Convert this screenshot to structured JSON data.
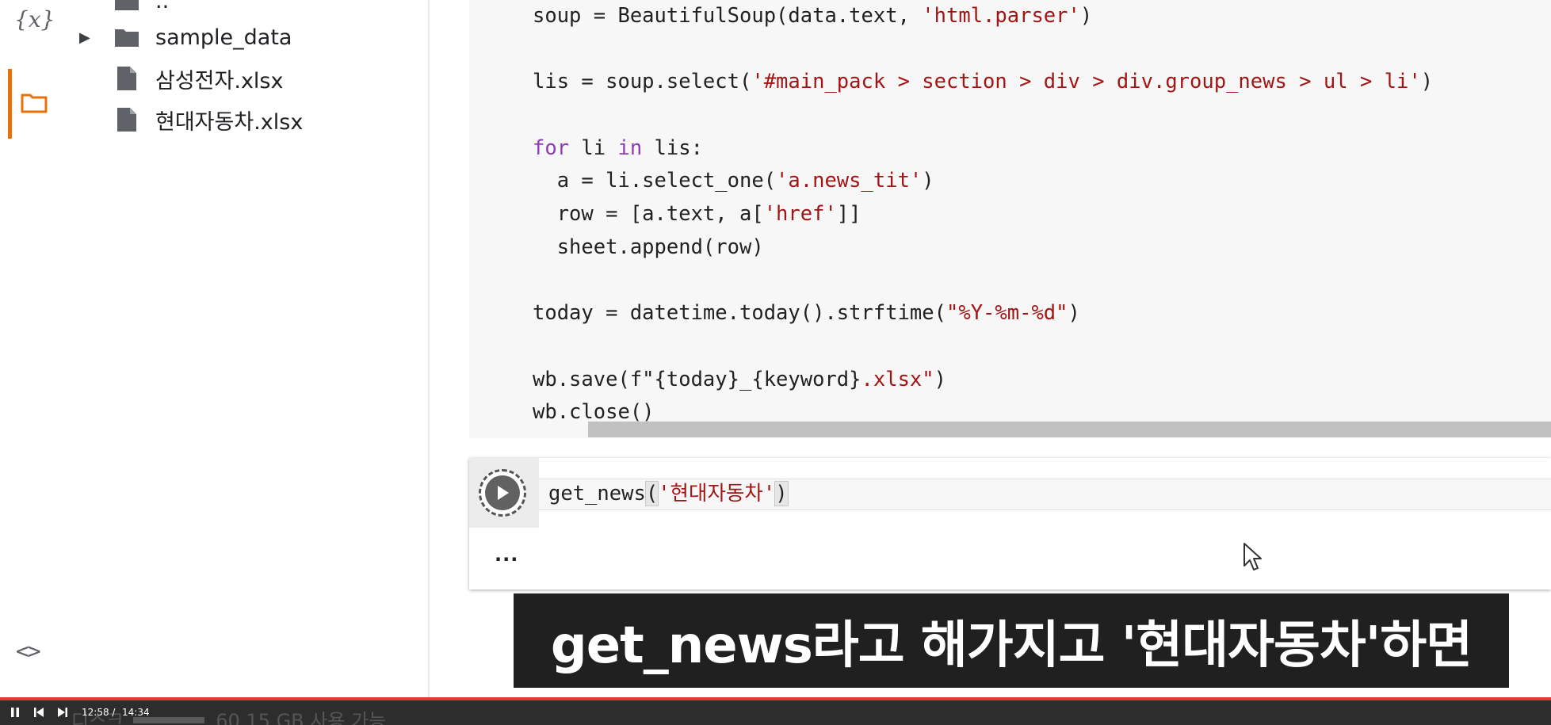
{
  "sidebar": {
    "icons": {
      "variables": "{x}",
      "files": "folder-icon",
      "code_snippets": "<>"
    },
    "active_color": "#e8710a"
  },
  "file_tree": {
    "items": [
      {
        "label": "..",
        "type": "folder"
      },
      {
        "label": "sample_data",
        "type": "folder",
        "expandable": true
      },
      {
        "label": "삼성전자.xlsx",
        "type": "file"
      },
      {
        "label": "현대자동차.xlsx",
        "type": "file"
      }
    ]
  },
  "code_cell": {
    "lines": [
      [
        {
          "t": "soup = BeautifulSoup(data.text, "
        },
        {
          "t": "'html.parser'",
          "c": "str"
        },
        {
          "t": ")"
        }
      ],
      [],
      [
        {
          "t": "lis = soup.select("
        },
        {
          "t": "'#main_pack > section > div > div.group_news > ul > li'",
          "c": "str"
        },
        {
          "t": ")"
        }
      ],
      [],
      [
        {
          "t": "for",
          "c": "kw"
        },
        {
          "t": " li "
        },
        {
          "t": "in",
          "c": "kw"
        },
        {
          "t": " lis:"
        }
      ],
      [
        {
          "t": "  a = li.select_one("
        },
        {
          "t": "'a.news_tit'",
          "c": "str"
        },
        {
          "t": ")"
        }
      ],
      [
        {
          "t": "  row = [a.text, a["
        },
        {
          "t": "'href'",
          "c": "str"
        },
        {
          "t": "]]"
        }
      ],
      [
        {
          "t": "  sheet.append(row)"
        }
      ],
      [],
      [
        {
          "t": "today = datetime.today().strftime("
        },
        {
          "t": "\"%Y-%m-%d\"",
          "c": "str"
        },
        {
          "t": ")"
        }
      ],
      [],
      [
        {
          "t": "wb.save(f\"{today}_{keyword}"
        },
        {
          "t": ".xlsx\"",
          "c": "str"
        },
        {
          "t": ")"
        }
      ],
      [
        {
          "t": "wb.close()"
        }
      ]
    ]
  },
  "run_cell": {
    "code_prefix": "get_news",
    "open_paren": "(",
    "argument": "'현대자동차'",
    "close_paren": ")",
    "output": "..."
  },
  "subtitle": "get_news라고 해가지고 '현대자동차'하면",
  "player": {
    "current_time": "12:58 /",
    "total_time": "14:34",
    "underlay_left": "디스크",
    "underlay_right": "60.15 GB 사용 가능",
    "progress_color": "#e53935"
  }
}
